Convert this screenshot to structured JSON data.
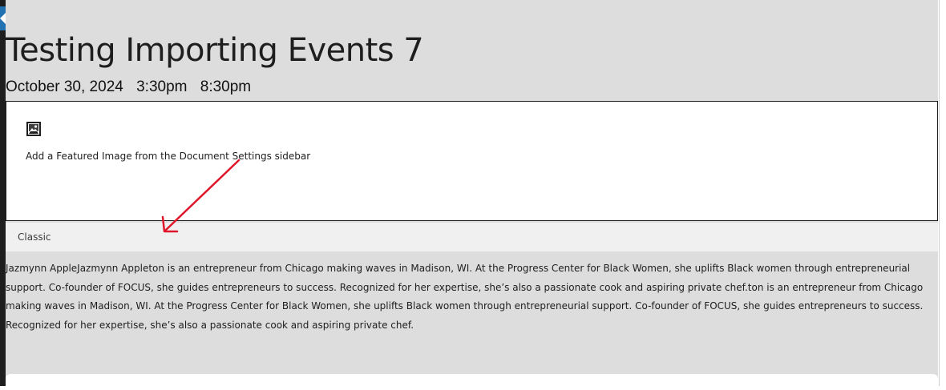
{
  "event": {
    "title": "Testing Importing Events 7",
    "date": "October 30, 2024",
    "start_time": "3:30pm",
    "end_time": "8:30pm"
  },
  "featured_image": {
    "icon": "image-icon",
    "hint": "Add a Featured Image from the Document Settings sidebar"
  },
  "classic_block": {
    "label": "Classic"
  },
  "content": {
    "paragraph": "Jazmynn AppleJazmynn Appleton is an entrepreneur from Chicago making waves in Madison, WI. At the Progress Center for Black Women, she uplifts Black women through entrepreneurial support. Co-founder of FOCUS, she guides entrepreneurs to success. Recognized for her expertise, she’s also a passionate cook and aspiring private chef.ton is an entrepreneur from Chicago making waves in Madison, WI. At the Progress Center for Black Women, she uplifts Black women through entrepreneurial support. Co-founder of FOCUS, she guides entrepreneurs to success. Recognized for her expertise, she’s also a passionate cook and aspiring private chef."
  },
  "colors": {
    "canvas": "#dddddd",
    "annotation_arrow": "#e0162b",
    "admin_accent": "#2271b1"
  }
}
